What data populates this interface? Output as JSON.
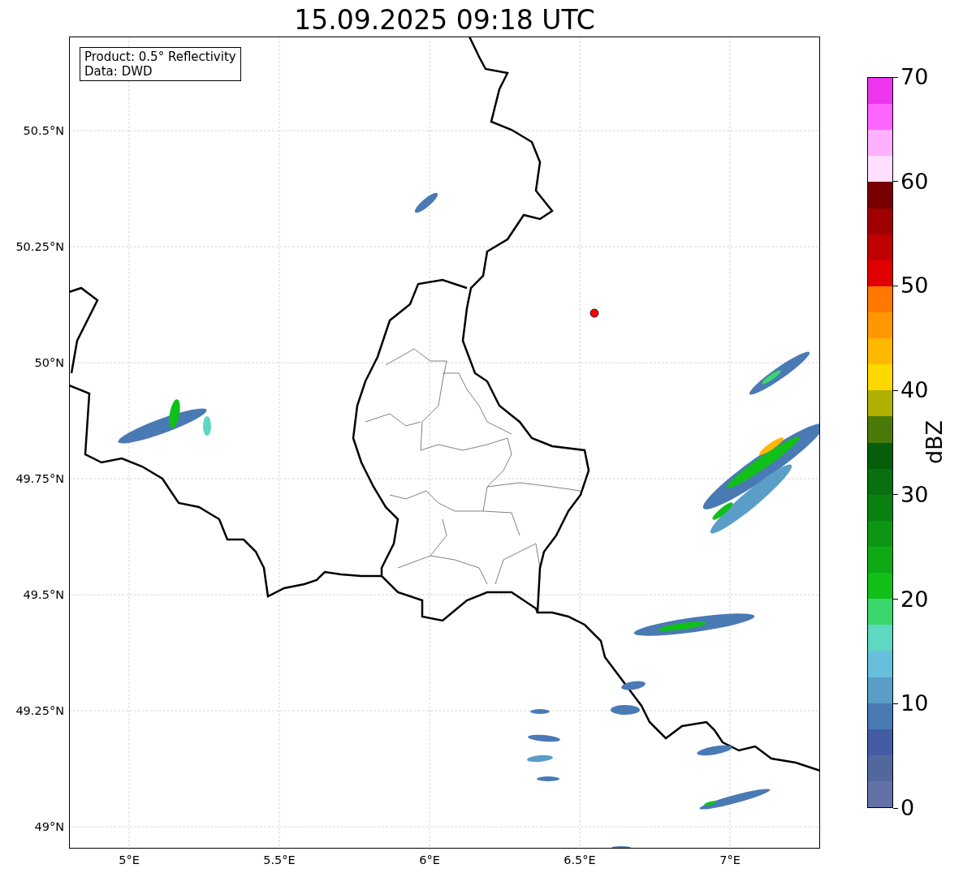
{
  "title": "15.09.2025 09:18 UTC",
  "info_box": [
    "Product: 0.5° Reflectivity",
    "Data: DWD"
  ],
  "x_axis": {
    "ticks": [
      {
        "label": "5°E"
      },
      {
        "label": "5.5°E"
      },
      {
        "label": "6°E"
      },
      {
        "label": "6.5°E"
      },
      {
        "label": "7°E"
      }
    ]
  },
  "y_axis": {
    "ticks": [
      {
        "label": "50.5°N"
      },
      {
        "label": "50.25°N"
      },
      {
        "label": "50°N"
      },
      {
        "label": "49.75°N"
      },
      {
        "label": "49.5°N"
      },
      {
        "label": "49.25°N"
      },
      {
        "label": "49°N"
      }
    ]
  },
  "colorbar": {
    "label": "dBZ",
    "ticks": [
      {
        "label": "70"
      },
      {
        "label": "60"
      },
      {
        "label": "50"
      },
      {
        "label": "40"
      },
      {
        "label": "30"
      },
      {
        "label": "20"
      },
      {
        "label": "10"
      },
      {
        "label": "0"
      }
    ],
    "bins": [
      {
        "color": "#6272a6"
      },
      {
        "color": "#52689c"
      },
      {
        "color": "#445ca4"
      },
      {
        "color": "#4a7ab4"
      },
      {
        "color": "#5a9ec8"
      },
      {
        "color": "#66c0dc"
      },
      {
        "color": "#5ed8c0"
      },
      {
        "color": "#3cd66e"
      },
      {
        "color": "#10c018"
      },
      {
        "color": "#0eaa16"
      },
      {
        "color": "#0c9614"
      },
      {
        "color": "#0a8212"
      },
      {
        "color": "#087010"
      },
      {
        "color": "#065e0a"
      },
      {
        "color": "#4a7a0a"
      },
      {
        "color": "#b0b000"
      },
      {
        "color": "#ffd800"
      },
      {
        "color": "#ffb800"
      },
      {
        "color": "#ff9800"
      },
      {
        "color": "#ff7800"
      },
      {
        "color": "#e00000"
      },
      {
        "color": "#c00000"
      },
      {
        "color": "#a00000"
      },
      {
        "color": "#780000"
      },
      {
        "color": "#ffe0ff"
      },
      {
        "color": "#ffb0ff"
      },
      {
        "color": "#ff66ff"
      },
      {
        "color": "#ec35ec"
      }
    ]
  }
}
